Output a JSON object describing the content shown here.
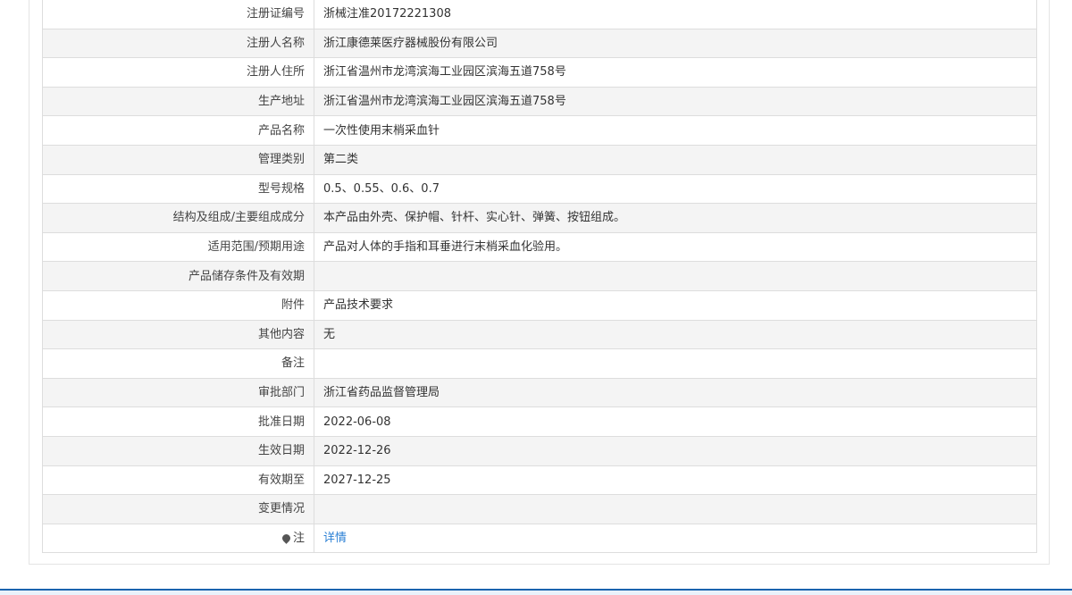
{
  "rows": [
    {
      "label": "注册证编号",
      "value": "浙械注准20172221308"
    },
    {
      "label": "注册人名称",
      "value": "浙江康德莱医疗器械股份有限公司"
    },
    {
      "label": "注册人住所",
      "value": "浙江省温州市龙湾滨海工业园区滨海五道758号"
    },
    {
      "label": "生产地址",
      "value": "浙江省温州市龙湾滨海工业园区滨海五道758号"
    },
    {
      "label": "产品名称",
      "value": "一次性使用末梢采血针"
    },
    {
      "label": "管理类别",
      "value": "第二类"
    },
    {
      "label": "型号规格",
      "value": "0.5、0.55、0.6、0.7"
    },
    {
      "label": "结构及组成/主要组成成分",
      "value": "本产品由外壳、保护帽、针杆、实心针、弹簧、按钮组成。"
    },
    {
      "label": "适用范围/预期用途",
      "value": "产品对人体的手指和耳垂进行末梢采血化验用。"
    },
    {
      "label": "产品储存条件及有效期",
      "value": ""
    },
    {
      "label": "附件",
      "value": "产品技术要求"
    },
    {
      "label": "其他内容",
      "value": "无"
    },
    {
      "label": "备注",
      "value": ""
    },
    {
      "label": "审批部门",
      "value": "浙江省药品监督管理局"
    },
    {
      "label": "批准日期",
      "value": "2022-06-08"
    },
    {
      "label": "生效日期",
      "value": "2022-12-26"
    },
    {
      "label": "有效期至",
      "value": "2027-12-25"
    },
    {
      "label": "变更情况",
      "value": ""
    }
  ],
  "note_row": {
    "icon": "pin-icon",
    "label": "注",
    "link_text": "详情"
  },
  "colors": {
    "link": "#2a7fd4",
    "footer_border": "#1b63ae",
    "row_alt": "#f4f4f4"
  }
}
